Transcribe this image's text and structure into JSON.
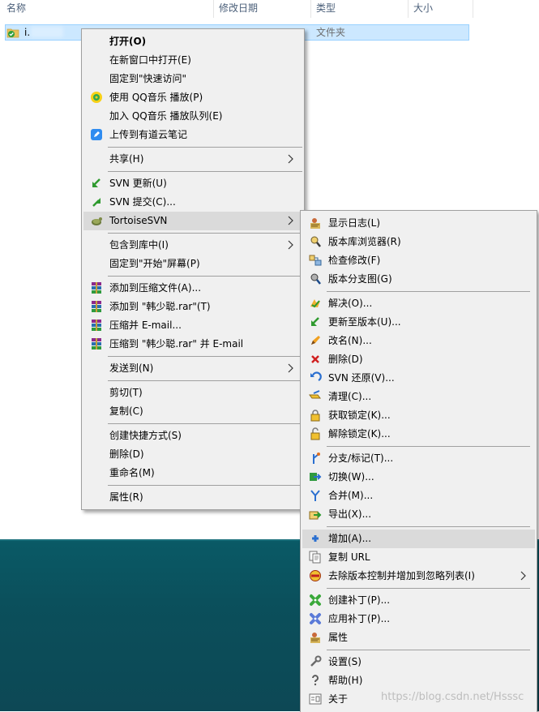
{
  "explorer": {
    "columns": [
      "名称",
      "修改日期",
      "类型",
      "大小"
    ],
    "file": {
      "name": "i.",
      "type": "文件夹"
    }
  },
  "context_menu": {
    "items": [
      {
        "label": "打开(O)",
        "icon": "none"
      },
      {
        "label": "在新窗口中打开(E)",
        "icon": "none"
      },
      {
        "label": "固定到\"快速访问\"",
        "icon": "none"
      },
      {
        "label": "使用 QQ音乐 播放(P)",
        "icon": "qq-music-icon"
      },
      {
        "label": "加入 QQ音乐 播放队列(E)",
        "icon": "none"
      },
      {
        "label": "上传到有道云笔记",
        "icon": "youdao-note-icon"
      },
      {
        "label": "共享(H)",
        "icon": "none"
      },
      {
        "label": "SVN 更新(U)",
        "icon": "svn-update-icon"
      },
      {
        "label": "SVN 提交(C)...",
        "icon": "svn-commit-icon"
      },
      {
        "label": "TortoiseSVN",
        "icon": "tortoise-icon"
      },
      {
        "label": "包含到库中(I)",
        "icon": "none"
      },
      {
        "label": "固定到\"开始\"屏幕(P)",
        "icon": "none"
      },
      {
        "label": "添加到压缩文件(A)...",
        "icon": "winrar-icon"
      },
      {
        "label": "添加到 \"韩少聪.rar\"(T)",
        "icon": "winrar-icon"
      },
      {
        "label": "压缩并 E-mail...",
        "icon": "winrar-icon"
      },
      {
        "label": "压缩到 \"韩少聪.rar\" 并 E-mail",
        "icon": "winrar-icon"
      },
      {
        "label": "发送到(N)",
        "icon": "none"
      },
      {
        "label": "剪切(T)",
        "icon": "none"
      },
      {
        "label": "复制(C)",
        "icon": "none"
      },
      {
        "label": "创建快捷方式(S)",
        "icon": "none"
      },
      {
        "label": "删除(D)",
        "icon": "none"
      },
      {
        "label": "重命名(M)",
        "icon": "none"
      },
      {
        "label": "属性(R)",
        "icon": "none"
      }
    ]
  },
  "svn_menu": {
    "items": [
      {
        "label": "显示日志(L)",
        "icon": "show-log-icon"
      },
      {
        "label": "版本库浏览器(R)",
        "icon": "repo-browser-icon"
      },
      {
        "label": "检查修改(F)",
        "icon": "check-modifications-icon"
      },
      {
        "label": "版本分支图(G)",
        "icon": "revision-graph-icon"
      },
      {
        "label": "解决(O)...",
        "icon": "resolve-icon"
      },
      {
        "label": "更新至版本(U)...",
        "icon": "update-to-revision-icon"
      },
      {
        "label": "改名(N)...",
        "icon": "rename-icon"
      },
      {
        "label": "删除(D)",
        "icon": "delete-icon"
      },
      {
        "label": "SVN 还原(V)...",
        "icon": "revert-icon"
      },
      {
        "label": "清理(C)...",
        "icon": "cleanup-icon"
      },
      {
        "label": "获取锁定(K)...",
        "icon": "get-lock-icon"
      },
      {
        "label": "解除锁定(K)...",
        "icon": "release-lock-icon"
      },
      {
        "label": "分支/标记(T)...",
        "icon": "branch-tag-icon"
      },
      {
        "label": "切换(W)...",
        "icon": "switch-icon"
      },
      {
        "label": "合并(M)...",
        "icon": "merge-icon"
      },
      {
        "label": "导出(X)...",
        "icon": "export-icon"
      },
      {
        "label": "增加(A)...",
        "icon": "add-icon"
      },
      {
        "label": "复制 URL",
        "icon": "copy-url-icon"
      },
      {
        "label": "去除版本控制并增加到忽略列表(I)",
        "icon": "ignore-icon"
      },
      {
        "label": "创建补丁(P)...",
        "icon": "create-patch-icon"
      },
      {
        "label": "应用补丁(P)...",
        "icon": "apply-patch-icon"
      },
      {
        "label": "属性",
        "icon": "properties-icon"
      },
      {
        "label": "设置(S)",
        "icon": "settings-icon"
      },
      {
        "label": "帮助(H)",
        "icon": "help-icon"
      },
      {
        "label": "关于",
        "icon": "about-icon"
      }
    ]
  },
  "watermark": "https://blog.csdn.net/Hsssc"
}
